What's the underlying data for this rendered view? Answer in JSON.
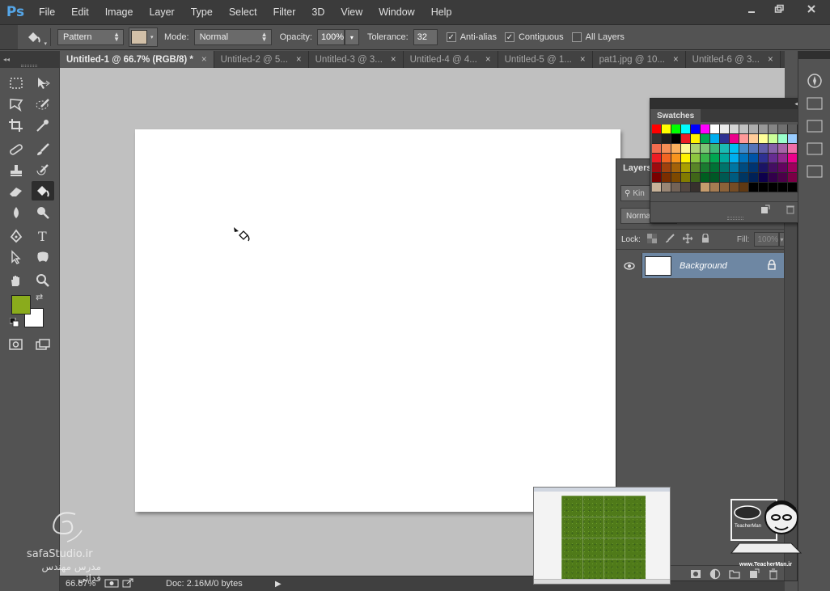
{
  "app": {
    "logo": "Ps",
    "menu": [
      "File",
      "Edit",
      "Image",
      "Layer",
      "Type",
      "Select",
      "Filter",
      "3D",
      "View",
      "Window",
      "Help"
    ]
  },
  "window_controls": [
    "minimize-icon",
    "restore-icon",
    "close-icon"
  ],
  "options_bar": {
    "fill_source": "Pattern",
    "fill_swatch_color": "#d2c0a8",
    "mode_label": "Mode:",
    "mode_value": "Normal",
    "opacity_label": "Opacity:",
    "opacity_value": "100%",
    "tolerance_label": "Tolerance:",
    "tolerance_value": "32",
    "antialias_label": "Anti-alias",
    "antialias_checked": true,
    "contiguous_label": "Contiguous",
    "contiguous_checked": true,
    "all_layers_label": "All Layers",
    "all_layers_checked": false
  },
  "tabs": [
    {
      "label": "Untitled-1 @ 66.7% (RGB/8) *",
      "active": true
    },
    {
      "label": "Untitled-2 @ 5...",
      "active": false
    },
    {
      "label": "Untitled-3 @ 3...",
      "active": false
    },
    {
      "label": "Untitled-4 @ 4...",
      "active": false
    },
    {
      "label": "Untitled-5 @ 1...",
      "active": false
    },
    {
      "label": "pat1.jpg @ 10...",
      "active": false
    },
    {
      "label": "Untitled-6 @ 3...",
      "active": false
    }
  ],
  "tab_close": "×",
  "tools": {
    "foreground_color": "#8aab1c",
    "background_color": "#ffffff",
    "active_tool": "paint-bucket-tool"
  },
  "status_bar": {
    "zoom": "66.67%",
    "doc_info": "Doc: 2.16M/0 bytes"
  },
  "layers_panel": {
    "tab_label": "Layers",
    "search_placeholder": "Kin",
    "blend_mode": "Norma",
    "lock_label": "Lock:",
    "fill_label": "Fill:",
    "fill_value": "100%",
    "layers": [
      {
        "name": "Background",
        "visible": true,
        "locked": true
      }
    ]
  },
  "swatches_panel": {
    "tab_label": "Swatches",
    "rows": [
      [
        "#ff0000",
        "#ffff00",
        "#00ff00",
        "#00ffff",
        "#0000ff",
        "#ff00ff",
        "#ffffff",
        "#ebebeb",
        "#d6d6d6",
        "#c2c2c2",
        "#adadad",
        "#999999",
        "#858585",
        "#707070",
        "#5c5c5c",
        "#474747"
      ],
      [
        "#333333",
        "#1f1f1f",
        "#000000",
        "#ed1c24",
        "#fff200",
        "#00a651",
        "#00aeef",
        "#2e3192",
        "#ec008c",
        "#ff9999",
        "#ffcc99",
        "#ffff99",
        "#ccff99",
        "#99ffcc",
        "#99ccff",
        "#cc99ff"
      ],
      [
        "#f26c4f",
        "#f68e56",
        "#fbaf5d",
        "#fff799",
        "#acd373",
        "#7cc576",
        "#3bb878",
        "#1abbb4",
        "#00bff3",
        "#438ccb",
        "#5574b9",
        "#605ca8",
        "#855fa8",
        "#a763a8",
        "#f06ea9",
        "#f26d7d"
      ],
      [
        "#ed1c24",
        "#f26522",
        "#f7941d",
        "#fff200",
        "#8dc63f",
        "#39b54a",
        "#00a651",
        "#00a99d",
        "#00aeef",
        "#0072bc",
        "#0054a6",
        "#2e3192",
        "#662d91",
        "#92278f",
        "#ec008c",
        "#ed145b"
      ],
      [
        "#9e0b0f",
        "#a0410d",
        "#a36209",
        "#aba000",
        "#598527",
        "#1a7b30",
        "#007236",
        "#00746b",
        "#0076a3",
        "#004b80",
        "#003471",
        "#1b1464",
        "#440e62",
        "#630460",
        "#9e005d",
        "#9e0039"
      ],
      [
        "#790000",
        "#7b2e00",
        "#7d4900",
        "#827b00",
        "#406618",
        "#005e20",
        "#005826",
        "#005952",
        "#005b7f",
        "#003663",
        "#002157",
        "#0d004c",
        "#32004b",
        "#4b0049",
        "#7b0046",
        "#7a0026"
      ],
      [
        "#c7b299",
        "#998675",
        "#736357",
        "#534741",
        "#37302d",
        "#c69c6d",
        "#a67c52",
        "#8c6239",
        "#754c24",
        "#603913",
        "#000000",
        "#000000",
        "#000000",
        "#000000",
        "#000000",
        "#000000"
      ]
    ]
  },
  "watermarks": {
    "left_text_latin": "safaStudio.ir",
    "left_text_persian": "مدرس مهندس فدائی",
    "right_text": "TeacherMan",
    "right_url": "www.TeacherMan.ir"
  },
  "overlay_thumbnail": {
    "pattern_color": "#4f7a19"
  }
}
